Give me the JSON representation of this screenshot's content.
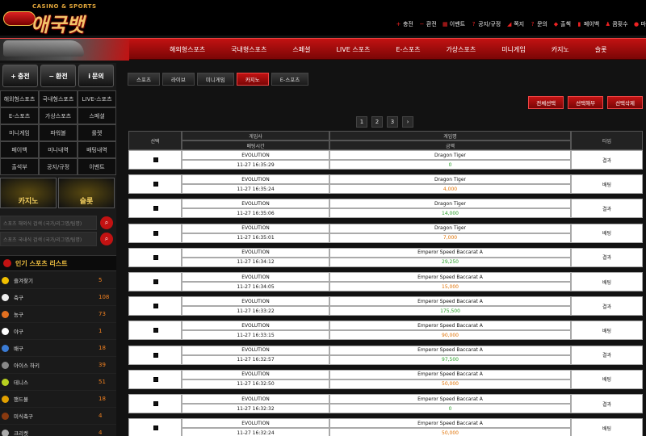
{
  "header": {
    "logo_sub": "CASINO & SPORTS",
    "logo_main": "애국뱃",
    "top_menu": [
      {
        "label": "충전",
        "icon": "+"
      },
      {
        "label": "환전",
        "icon": "−"
      },
      {
        "label": "이벤트",
        "icon": "▦"
      },
      {
        "label": "공지/규정",
        "icon": "?"
      },
      {
        "label": "쪽지",
        "icon": "◢"
      },
      {
        "label": "문의",
        "icon": "?"
      },
      {
        "label": "출첵",
        "icon": "◆"
      },
      {
        "label": "페이백",
        "icon": "▮"
      },
      {
        "label": "콤횟수",
        "icon": "♟"
      },
      {
        "label": "마",
        "icon": "●"
      }
    ]
  },
  "nav": [
    "해외형스포츠",
    "국내형스포츠",
    "스페셜",
    "LIVE 스포츠",
    "E-스포츠",
    "가상스포츠",
    "미니게임",
    "카지노",
    "슬롯"
  ],
  "sidebar": {
    "buttons": [
      {
        "label": "충전",
        "icon": "+"
      },
      {
        "label": "환전",
        "icon": "−"
      },
      {
        "label": "문의",
        "icon": "i"
      }
    ],
    "grid": [
      [
        "해외형스포츠",
        "국내형스포츠",
        "LIVE-스포츠"
      ],
      [
        "E-스포츠",
        "가상스포츠",
        "스페셜"
      ],
      [
        "미니게임",
        "파워볼",
        "룰렛"
      ],
      [
        "페이백",
        "미니내역",
        "배팅내역"
      ],
      [
        "출석부",
        "공지/규정",
        "이벤트"
      ]
    ],
    "banners": [
      {
        "label": "카지노"
      },
      {
        "label": "슬롯"
      }
    ],
    "search": [
      "스포츠 해외식 검색 (국가/리그명/팀명)",
      "스포츠 국내식 검색 (국가/리그명/팀명)"
    ],
    "popular_title": "인기 스포츠 리스트",
    "sports": [
      {
        "name": "즐겨찾기",
        "count": "5",
        "color": "#f2c000"
      },
      {
        "name": "축구",
        "count": "108",
        "color": "#eeeeee"
      },
      {
        "name": "농구",
        "count": "73",
        "color": "#e27020"
      },
      {
        "name": "야구",
        "count": "1",
        "color": "#ffffff"
      },
      {
        "name": "배구",
        "count": "18",
        "color": "#3a7bd5"
      },
      {
        "name": "아이스 하키",
        "count": "39",
        "color": "#888888"
      },
      {
        "name": "테니스",
        "count": "51",
        "color": "#b8d020"
      },
      {
        "name": "핸드볼",
        "count": "18",
        "color": "#e2a000"
      },
      {
        "name": "미식축구",
        "count": "4",
        "color": "#8a3a10"
      },
      {
        "name": "크리켓",
        "count": "4",
        "color": "#aaaaaa"
      }
    ]
  },
  "tabs": [
    "스포츠",
    "라이브",
    "미니게임",
    "카지노",
    "E-스포츠"
  ],
  "active_tab": 3,
  "actions": [
    "전체선택",
    "선택해부",
    "선택삭제"
  ],
  "pages": [
    "1",
    "2",
    "3",
    "›"
  ],
  "table": {
    "headers": {
      "select": "선택",
      "provider": "게임사",
      "bet_time": "배팅시간",
      "game": "게임명",
      "amount": "금액",
      "type": "타입"
    },
    "rows": [
      {
        "provider": "EVOLUTION",
        "time": "11-27 16:35:29",
        "game": "Dragon Tiger",
        "amount": "0",
        "amount_color": "#2aa02a",
        "type": "결과"
      },
      {
        "provider": "EVOLUTION",
        "time": "11-27 16:35:24",
        "game": "Dragon Tiger",
        "amount": "4,000",
        "amount_color": "#e07000",
        "type": "배팅"
      },
      {
        "provider": "EVOLUTION",
        "time": "11-27 16:35:06",
        "game": "Dragon Tiger",
        "amount": "14,000",
        "amount_color": "#2aa02a",
        "type": "결과"
      },
      {
        "provider": "EVOLUTION",
        "time": "11-27 16:35:01",
        "game": "Dragon Tiger",
        "amount": "7,000",
        "amount_color": "#e07000",
        "type": "배팅"
      },
      {
        "provider": "EVOLUTION",
        "time": "11-27 16:34:12",
        "game": "Emperor Speed Baccarat A",
        "amount": "29,250",
        "amount_color": "#2aa02a",
        "type": "결과"
      },
      {
        "provider": "EVOLUTION",
        "time": "11-27 16:34:05",
        "game": "Emperor Speed Baccarat A",
        "amount": "15,000",
        "amount_color": "#e07000",
        "type": "배팅"
      },
      {
        "provider": "EVOLUTION",
        "time": "11-27 16:33:22",
        "game": "Emperor Speed Baccarat A",
        "amount": "175,500",
        "amount_color": "#2aa02a",
        "type": "결과"
      },
      {
        "provider": "EVOLUTION",
        "time": "11-27 16:33:15",
        "game": "Emperor Speed Baccarat A",
        "amount": "90,000",
        "amount_color": "#e07000",
        "type": "배팅"
      },
      {
        "provider": "EVOLUTION",
        "time": "11-27 16:32:57",
        "game": "Emperor Speed Baccarat A",
        "amount": "97,500",
        "amount_color": "#2aa02a",
        "type": "결과"
      },
      {
        "provider": "EVOLUTION",
        "time": "11-27 16:32:50",
        "game": "Emperor Speed Baccarat A",
        "amount": "50,000",
        "amount_color": "#e07000",
        "type": "배팅"
      },
      {
        "provider": "EVOLUTION",
        "time": "11-27 16:32:32",
        "game": "Emperor Speed Baccarat A",
        "amount": "0",
        "amount_color": "#2aa02a",
        "type": "결과"
      },
      {
        "provider": "EVOLUTION",
        "time": "11-27 16:32:24",
        "game": "Emperor Speed Baccarat A",
        "amount": "50,000",
        "amount_color": "#e07000",
        "type": "배팅"
      }
    ]
  }
}
